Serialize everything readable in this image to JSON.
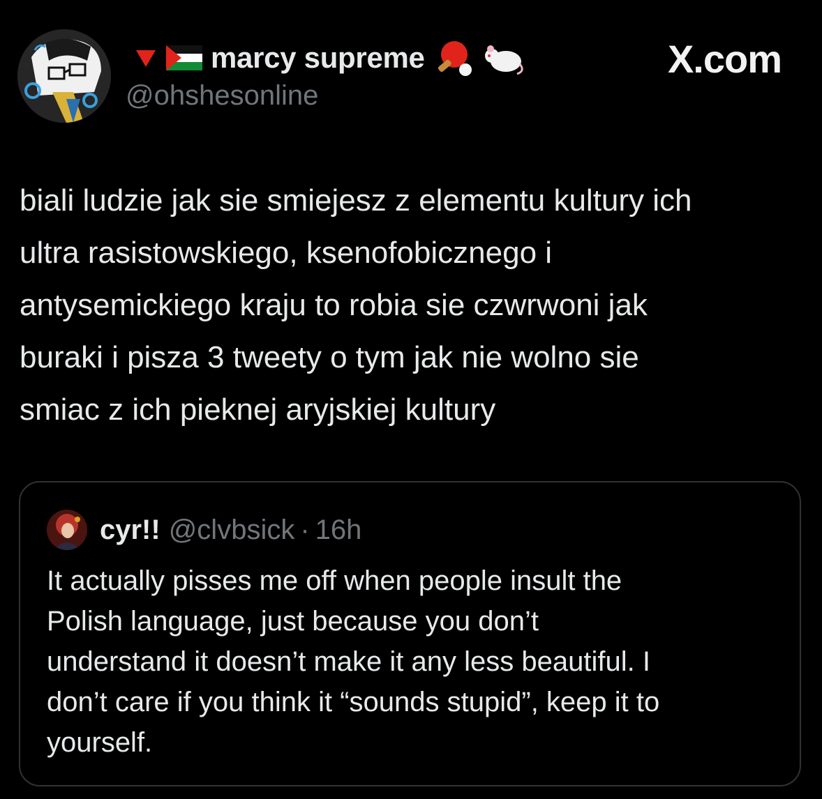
{
  "site": "X.com",
  "author": {
    "display_name": "marcy supreme",
    "handle": "@ohshesonline",
    "avatar": "avatar-drawing",
    "name_prefix_icons": [
      "red-triangle-down-icon",
      "palestine-flag-icon"
    ],
    "name_suffix_icons": [
      "ping-pong-icon",
      "rat-icon"
    ]
  },
  "post": {
    "lines": [
      "biali ludzie jak sie smiejesz z elementu kultury ich",
      "ultra rasistowskiego, ksenofobicznego i",
      "antysemickiego kraju to robia sie czwrwoni jak",
      "buraki i pisza 3 tweety o tym jak nie wolno sie",
      "smiac z ich pieknej aryjskiej kultury"
    ]
  },
  "quote": {
    "display_name": "cyr!!",
    "handle": "@clvbsick",
    "separator": "·",
    "time": "16h",
    "lines": [
      "It actually pisses me off when people insult the",
      "Polish language, just because you don’t",
      "understand it doesn’t make it any less beautiful. I",
      "don’t care if you think it “sounds stupid”, keep it to",
      "yourself."
    ]
  },
  "colors": {
    "background": "#000000",
    "text": "#e7e9ea",
    "secondary": "#71767b",
    "border": "#2f3336"
  }
}
